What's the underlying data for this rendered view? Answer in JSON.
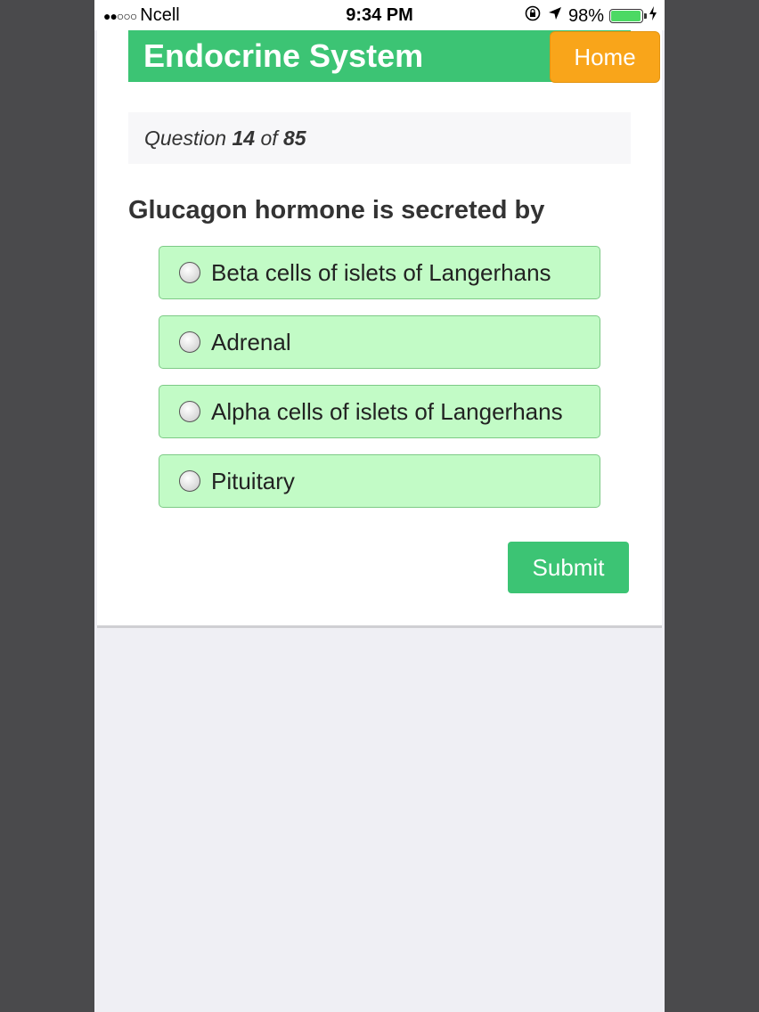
{
  "status_bar": {
    "signal_dots": "●●○○○",
    "carrier": "Ncell",
    "time": "9:34 PM",
    "battery_percent": "98%",
    "battery_level": 0.98,
    "icons": [
      "orientation-lock-icon",
      "location-arrow-icon",
      "battery-icon",
      "charging-bolt-icon"
    ]
  },
  "header": {
    "title": "Endocrine System",
    "home_label": "Home"
  },
  "progress": {
    "prefix": "Question",
    "current": "14",
    "middle": "of",
    "total": "85"
  },
  "question": {
    "text": "Glucagon hormone is secreted by",
    "options": [
      {
        "label": "Beta cells of islets of Langerhans",
        "selected": false
      },
      {
        "label": "Adrenal",
        "selected": false
      },
      {
        "label": "Alpha cells of islets of Langerhans",
        "selected": false
      },
      {
        "label": "Pituitary",
        "selected": false
      }
    ]
  },
  "submit_label": "Submit",
  "colors": {
    "accent_green": "#3cc474",
    "home_orange": "#f9a51a",
    "option_bg": "#c2fbc6",
    "option_border": "#7dca86"
  }
}
